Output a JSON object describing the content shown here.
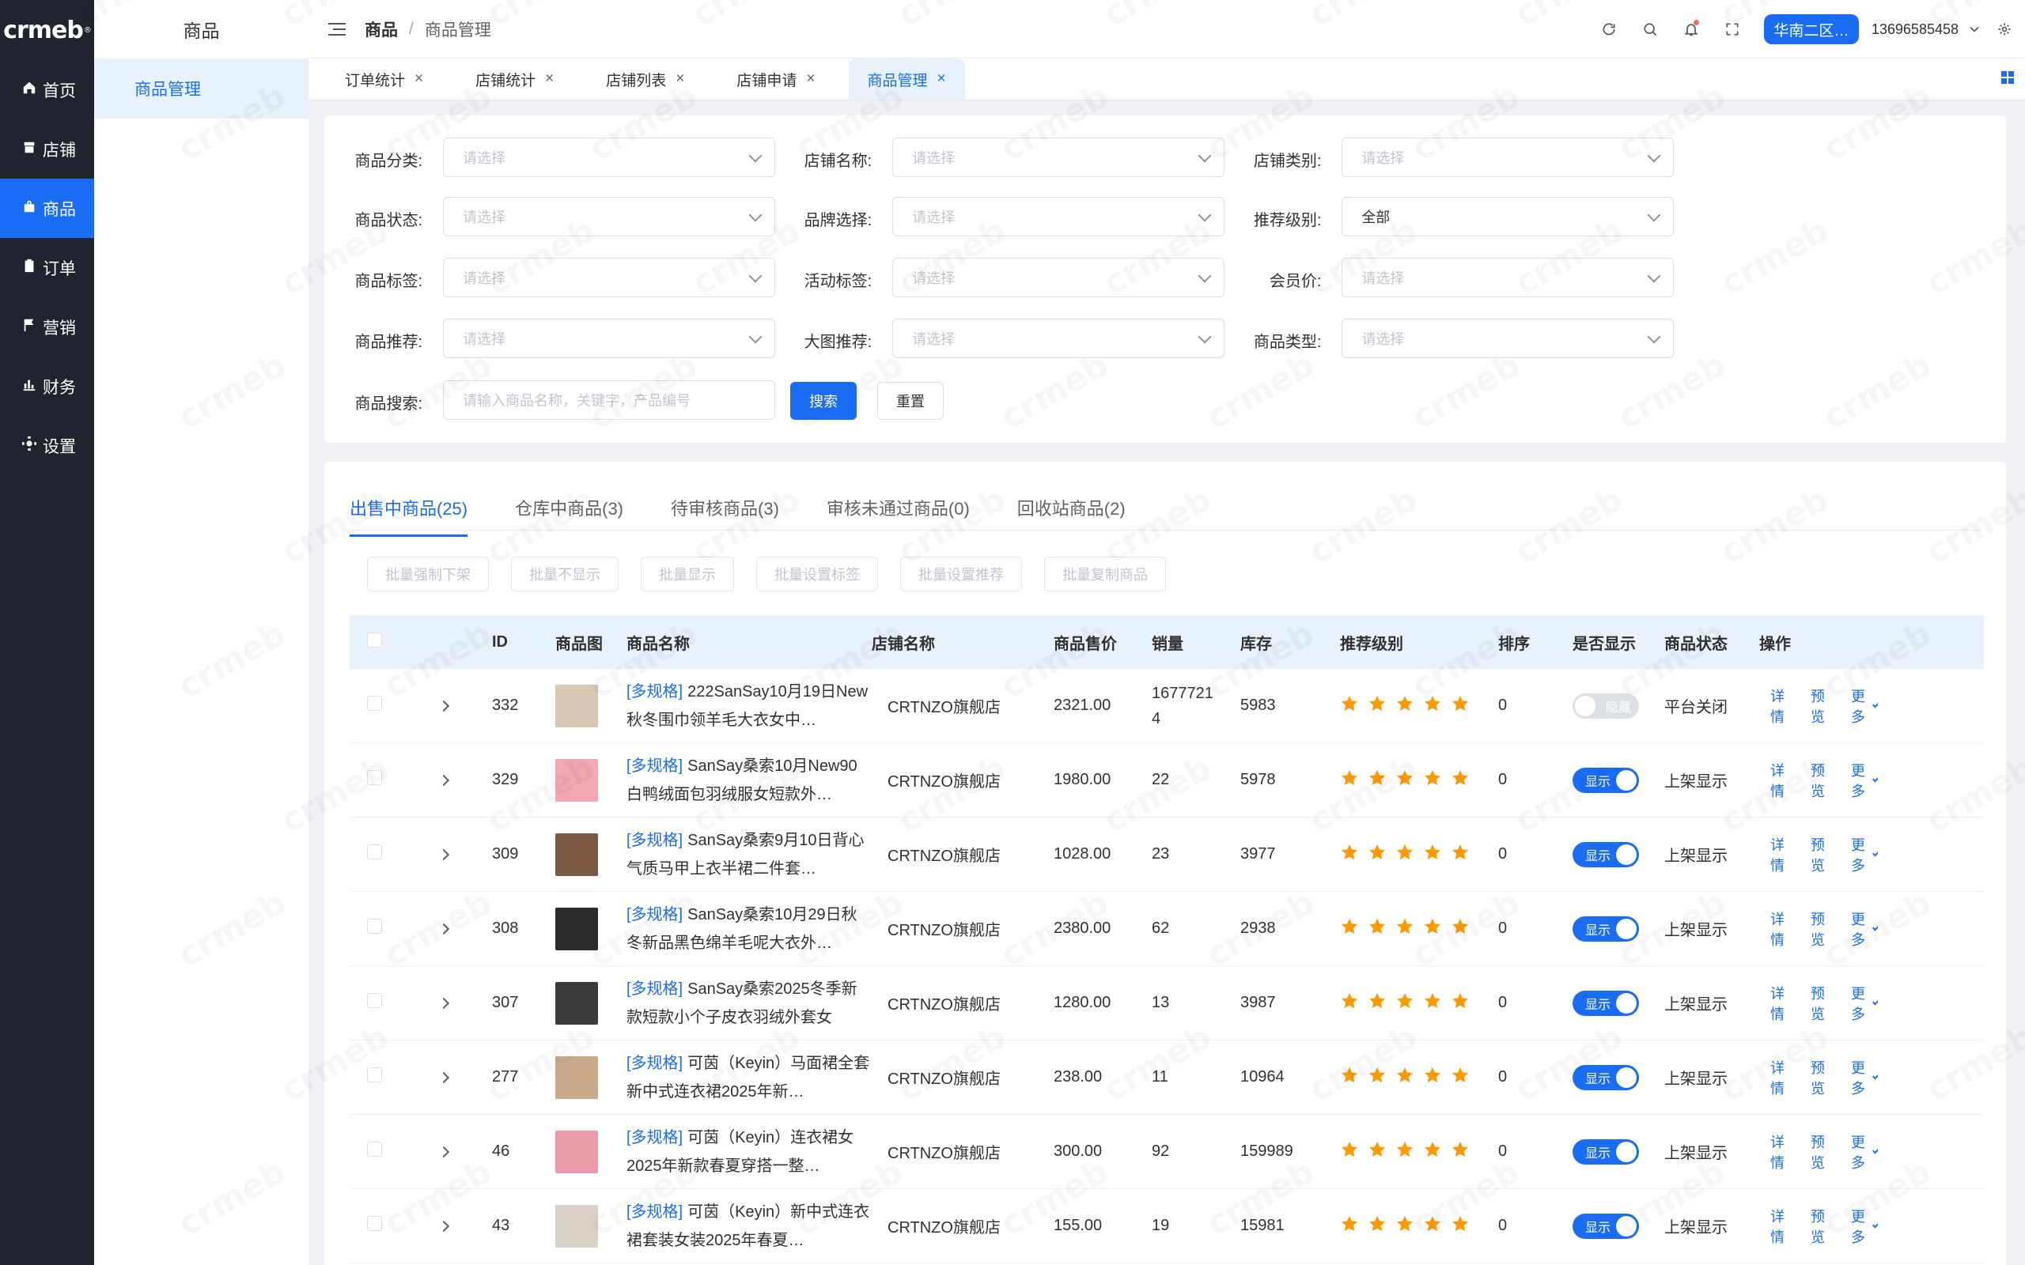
{
  "app": {
    "logo": "crmeb"
  },
  "main_menu": [
    {
      "label": "首页",
      "icon": "home-icon"
    },
    {
      "label": "店铺",
      "icon": "store-icon"
    },
    {
      "label": "商品",
      "icon": "bag-icon",
      "active": true
    },
    {
      "label": "订单",
      "icon": "clipboard-icon"
    },
    {
      "label": "营销",
      "icon": "flag-icon"
    },
    {
      "label": "财务",
      "icon": "bar-chart-icon"
    },
    {
      "label": "设置",
      "icon": "gear-icon"
    }
  ],
  "sub_sidebar": {
    "title": "商品",
    "item": "商品管理"
  },
  "header": {
    "breadcrumb": [
      "商品",
      "/",
      "商品管理"
    ],
    "region_button": "华南二区…",
    "account": "13696585458"
  },
  "open_tabs": [
    "订单统计",
    "店铺统计",
    "店铺列表",
    "店铺申请",
    "商品管理"
  ],
  "filters": {
    "category_label": "商品分类:",
    "store_name_label": "店铺名称:",
    "store_type_label": "店铺类别:",
    "status_label": "商品状态:",
    "brand_label": "品牌选择:",
    "recommend_level_label": "推荐级别:",
    "product_tag_label": "商品标签:",
    "activity_tag_label": "活动标签:",
    "member_price_label": "会员价:",
    "recommend_label": "商品推荐:",
    "big_image_label": "大图推荐:",
    "product_type_label": "商品类型:",
    "search_label": "商品搜索:",
    "placeholder": "请选择",
    "recommend_level_value": "全部",
    "search_placeholder": "请输入商品名称，关键字，产品编号",
    "search_button": "搜索",
    "reset_button": "重置"
  },
  "status_tabs": [
    "出售中商品(25)",
    "仓库中商品(3)",
    "待审核商品(3)",
    "审核未通过商品(0)",
    "回收站商品(2)"
  ],
  "batch_buttons": [
    "批量强制下架",
    "批量不显示",
    "批量显示",
    "批量设置标签",
    "批量设置推荐",
    "批量复制商品"
  ],
  "table": {
    "columns": [
      "ID",
      "商品图",
      "商品名称",
      "店铺名称",
      "商品售价",
      "销量",
      "库存",
      "推荐级别",
      "排序",
      "是否显示",
      "商品状态",
      "操作"
    ],
    "rows": [
      {
        "id": "332",
        "tag": "[多规格]",
        "name": "222SanSay10月19日New秋冬围巾领羊毛大衣女中…",
        "store": "CRTNZO旗舰店",
        "price": "2321.00",
        "sales": "16777214",
        "stock": "5983",
        "stars": 5,
        "sort": "0",
        "show": "隐藏",
        "show_on": false,
        "status": "平台关闭",
        "thumb_color": "#d8c7b3"
      },
      {
        "id": "329",
        "tag": "[多规格]",
        "name": "SanSay桑索10月New90白鸭绒面包羽绒服女短款外…",
        "store": "CRTNZO旗舰店",
        "price": "1980.00",
        "sales": "22",
        "stock": "5978",
        "stars": 5,
        "sort": "0",
        "show": "显示",
        "show_on": true,
        "status": "上架显示",
        "thumb_color": "#f2a7b5"
      },
      {
        "id": "309",
        "tag": "[多规格]",
        "name": "SanSay桑索9月10日背心气质马甲上衣半裙二件套…",
        "store": "CRTNZO旗舰店",
        "price": "1028.00",
        "sales": "23",
        "stock": "3977",
        "stars": 5,
        "sort": "0",
        "show": "显示",
        "show_on": true,
        "status": "上架显示",
        "thumb_color": "#7a5a44"
      },
      {
        "id": "308",
        "tag": "[多规格]",
        "name": "SanSay桑索10月29日秋冬新品黑色绵羊毛呢大衣外…",
        "store": "CRTNZO旗舰店",
        "price": "2380.00",
        "sales": "62",
        "stock": "2938",
        "stars": 5,
        "sort": "0",
        "show": "显示",
        "show_on": true,
        "status": "上架显示",
        "thumb_color": "#2a2a2a"
      },
      {
        "id": "307",
        "tag": "[多规格]",
        "name": "SanSay桑索2025冬季新款短款小个子皮衣羽绒外套女",
        "store": "CRTNZO旗舰店",
        "price": "1280.00",
        "sales": "13",
        "stock": "3987",
        "stars": 5,
        "sort": "0",
        "show": "显示",
        "show_on": true,
        "status": "上架显示",
        "thumb_color": "#3a3a3a"
      },
      {
        "id": "277",
        "tag": "[多规格]",
        "name": "可茵（Keyin）马面裙全套新中式连衣裙2025年新…",
        "store": "CRTNZO旗舰店",
        "price": "238.00",
        "sales": "11",
        "stock": "10964",
        "stars": 5,
        "sort": "0",
        "show": "显示",
        "show_on": true,
        "status": "上架显示",
        "thumb_color": "#c9a98a"
      },
      {
        "id": "46",
        "tag": "[多规格]",
        "name": "可茵（Keyin）连衣裙女2025年新款春夏穿搭一整…",
        "store": "CRTNZO旗舰店",
        "price": "300.00",
        "sales": "92",
        "stock": "159989",
        "stars": 5,
        "sort": "0",
        "show": "显示",
        "show_on": true,
        "status": "上架显示",
        "thumb_color": "#e89aa8"
      },
      {
        "id": "43",
        "tag": "[多规格]",
        "name": "可茵（Keyin）新中式连衣裙套装女装2025年春夏…",
        "store": "CRTNZO旗舰店",
        "price": "155.00",
        "sales": "19",
        "stock": "15981",
        "stars": 5,
        "sort": "0",
        "show": "显示",
        "show_on": true,
        "status": "上架显示",
        "thumb_color": "#d9d0c6"
      }
    ],
    "ops": [
      "详情",
      "预览",
      "更多"
    ]
  },
  "colors": {
    "primary": "#1a6cf5",
    "sidebar": "#1f2430",
    "star": "#ff9900"
  }
}
